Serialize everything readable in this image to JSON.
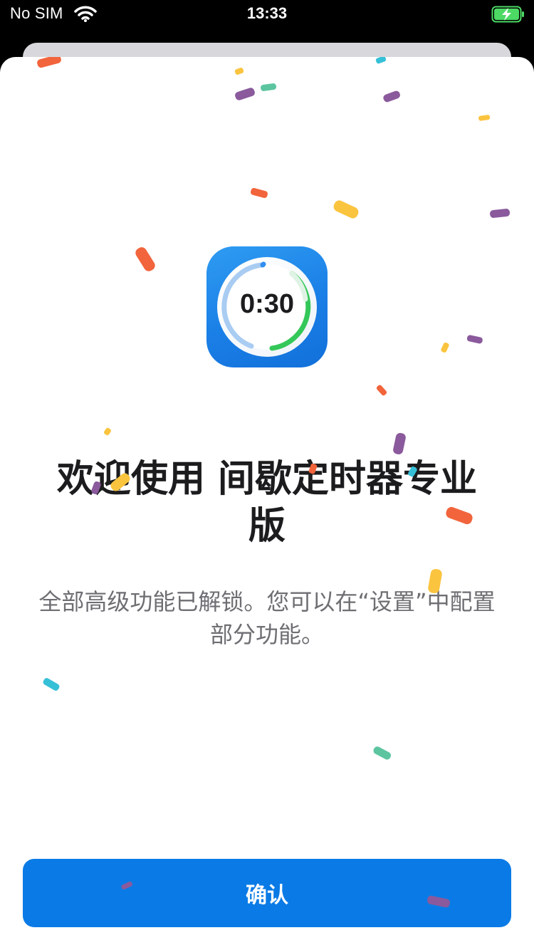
{
  "status_bar": {
    "carrier": "No SIM",
    "time": "13:33",
    "icons": [
      "wifi-icon",
      "battery-charging-icon"
    ]
  },
  "app_icon": {
    "name": "timer-ring-icon",
    "timer_text": "0:30"
  },
  "title": "欢迎使用 间歇定时器专业版",
  "subtitle": "全部高级功能已解锁。您可以在“设置”中配置部分功能。",
  "confirm_button": {
    "label": "确认"
  },
  "colors": {
    "accent": "#0a7be6",
    "confetti": [
      "#f2643c",
      "#8a5a9c",
      "#fbc43f",
      "#5cc5a0",
      "#36c0d8"
    ]
  }
}
